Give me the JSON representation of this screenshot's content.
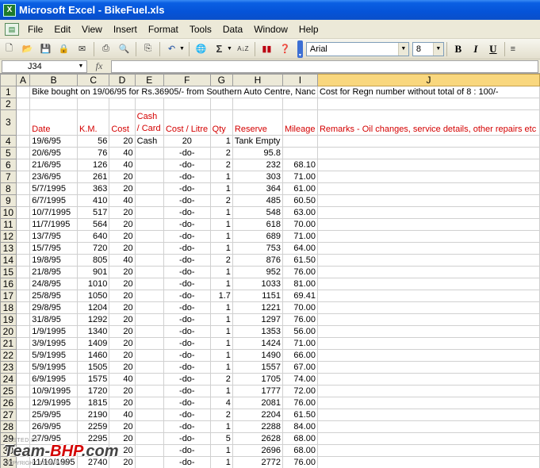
{
  "window": {
    "title": "Microsoft Excel - BikeFuel.xls"
  },
  "menu": [
    "File",
    "Edit",
    "View",
    "Insert",
    "Format",
    "Tools",
    "Data",
    "Window",
    "Help"
  ],
  "toolbar": {
    "font_name": "Arial",
    "font_size": "8",
    "bold": "B",
    "italic": "I",
    "underline": "U",
    "sum": "Σ",
    "sort": "A↓Z"
  },
  "formula_bar": {
    "name_box": "J34",
    "fx": "fx",
    "value": ""
  },
  "columns": [
    "A",
    "B",
    "C",
    "D",
    "E",
    "F",
    "G",
    "H",
    "I",
    "J"
  ],
  "selected_column": "J",
  "rows": [
    {
      "n": "1",
      "cells": [
        "",
        "Bike bought on 19/06/95 for Rs.36905/- from Southern Auto Centre, Nanc",
        "",
        "",
        "",
        "",
        "",
        "",
        "",
        "Cost for Regn number without total of 8 : 100/-"
      ]
    },
    {
      "n": "2",
      "cells": [
        "",
        "",
        "",
        "",
        "",
        "",
        "",
        "",
        "",
        ""
      ]
    },
    {
      "n": "3",
      "cells": [
        "",
        "Date",
        "K.M.",
        "Cost",
        "Cash / Card",
        "Cost / Litre",
        "Qty",
        "Reserve",
        "Mileage",
        "Remarks - Oil changes, service details, other repairs etc"
      ]
    },
    {
      "n": "4",
      "cells": [
        "",
        "19/6/95",
        "56",
        "20",
        "Cash",
        "20",
        "1",
        "Tank Empty",
        "",
        ""
      ]
    },
    {
      "n": "5",
      "cells": [
        "",
        "20/6/95",
        "76",
        "40",
        "",
        "-do-",
        "2",
        "95.8",
        "",
        ""
      ]
    },
    {
      "n": "6",
      "cells": [
        "",
        "21/6/95",
        "126",
        "40",
        "",
        "-do-",
        "2",
        "232",
        "68.10",
        ""
      ]
    },
    {
      "n": "7",
      "cells": [
        "",
        "23/6/95",
        "261",
        "20",
        "",
        "-do-",
        "1",
        "303",
        "71.00",
        ""
      ]
    },
    {
      "n": "8",
      "cells": [
        "",
        "5/7/1995",
        "363",
        "20",
        "",
        "-do-",
        "1",
        "364",
        "61.00",
        ""
      ]
    },
    {
      "n": "9",
      "cells": [
        "",
        "6/7/1995",
        "410",
        "40",
        "",
        "-do-",
        "2",
        "485",
        "60.50",
        ""
      ]
    },
    {
      "n": "10",
      "cells": [
        "",
        "10/7/1995",
        "517",
        "20",
        "",
        "-do-",
        "1",
        "548",
        "63.00",
        ""
      ]
    },
    {
      "n": "11",
      "cells": [
        "",
        "11/7/1995",
        "564",
        "20",
        "",
        "-do-",
        "1",
        "618",
        "70.00",
        ""
      ]
    },
    {
      "n": "12",
      "cells": [
        "",
        "13/7/95",
        "640",
        "20",
        "",
        "-do-",
        "1",
        "689",
        "71.00",
        ""
      ]
    },
    {
      "n": "13",
      "cells": [
        "",
        "15/7/95",
        "720",
        "20",
        "",
        "-do-",
        "1",
        "753",
        "64.00",
        ""
      ]
    },
    {
      "n": "14",
      "cells": [
        "",
        "19/8/95",
        "805",
        "40",
        "",
        "-do-",
        "2",
        "876",
        "61.50",
        ""
      ]
    },
    {
      "n": "15",
      "cells": [
        "",
        "21/8/95",
        "901",
        "20",
        "",
        "-do-",
        "1",
        "952",
        "76.00",
        ""
      ]
    },
    {
      "n": "16",
      "cells": [
        "",
        "24/8/95",
        "1010",
        "20",
        "",
        "-do-",
        "1",
        "1033",
        "81.00",
        ""
      ]
    },
    {
      "n": "17",
      "cells": [
        "",
        "25/8/95",
        "1050",
        "20",
        "",
        "-do-",
        "1.7",
        "1151",
        "69.41",
        ""
      ]
    },
    {
      "n": "18",
      "cells": [
        "",
        "29/8/95",
        "1204",
        "20",
        "",
        "-do-",
        "1",
        "1221",
        "70.00",
        ""
      ]
    },
    {
      "n": "19",
      "cells": [
        "",
        "31/8/95",
        "1292",
        "20",
        "",
        "-do-",
        "1",
        "1297",
        "76.00",
        ""
      ]
    },
    {
      "n": "20",
      "cells": [
        "",
        "1/9/1995",
        "1340",
        "20",
        "",
        "-do-",
        "1",
        "1353",
        "56.00",
        ""
      ]
    },
    {
      "n": "21",
      "cells": [
        "",
        "3/9/1995",
        "1409",
        "20",
        "",
        "-do-",
        "1",
        "1424",
        "71.00",
        ""
      ]
    },
    {
      "n": "22",
      "cells": [
        "",
        "5/9/1995",
        "1460",
        "20",
        "",
        "-do-",
        "1",
        "1490",
        "66.00",
        ""
      ]
    },
    {
      "n": "23",
      "cells": [
        "",
        "5/9/1995",
        "1505",
        "20",
        "",
        "-do-",
        "1",
        "1557",
        "67.00",
        ""
      ]
    },
    {
      "n": "24",
      "cells": [
        "",
        "6/9/1995",
        "1575",
        "40",
        "",
        "-do-",
        "2",
        "1705",
        "74.00",
        ""
      ]
    },
    {
      "n": "25",
      "cells": [
        "",
        "10/9/1995",
        "1720",
        "20",
        "",
        "-do-",
        "1",
        "1777",
        "72.00",
        ""
      ]
    },
    {
      "n": "26",
      "cells": [
        "",
        "12/9/1995",
        "1815",
        "20",
        "",
        "-do-",
        "4",
        "2081",
        "76.00",
        ""
      ]
    },
    {
      "n": "27",
      "cells": [
        "",
        "25/9/95",
        "2190",
        "40",
        "",
        "-do-",
        "2",
        "2204",
        "61.50",
        ""
      ]
    },
    {
      "n": "28",
      "cells": [
        "",
        "26/9/95",
        "2259",
        "20",
        "",
        "-do-",
        "1",
        "2288",
        "84.00",
        ""
      ]
    },
    {
      "n": "29",
      "cells": [
        "",
        "27/9/95",
        "2295",
        "20",
        "",
        "-do-",
        "5",
        "2628",
        "68.00",
        ""
      ]
    },
    {
      "n": "30",
      "cells": [
        "",
        "",
        "",
        "20",
        "",
        "-do-",
        "1",
        "2696",
        "68.00",
        ""
      ]
    },
    {
      "n": "31",
      "cells": [
        "",
        "11/10/1995",
        "2740",
        "20",
        "",
        "-do-",
        "1",
        "2772",
        "76.00",
        ""
      ]
    }
  ],
  "watermark": {
    "posted": "POSTED BY",
    "logo_a": "Team-",
    "logo_b": "BHP",
    "logo_c": ".com",
    "copyright": "COPYRIGHT RESERVED"
  },
  "colors": {
    "titlebar": "#0553d8",
    "header_red": "#d40000",
    "selected_col": "#f9d77e"
  }
}
